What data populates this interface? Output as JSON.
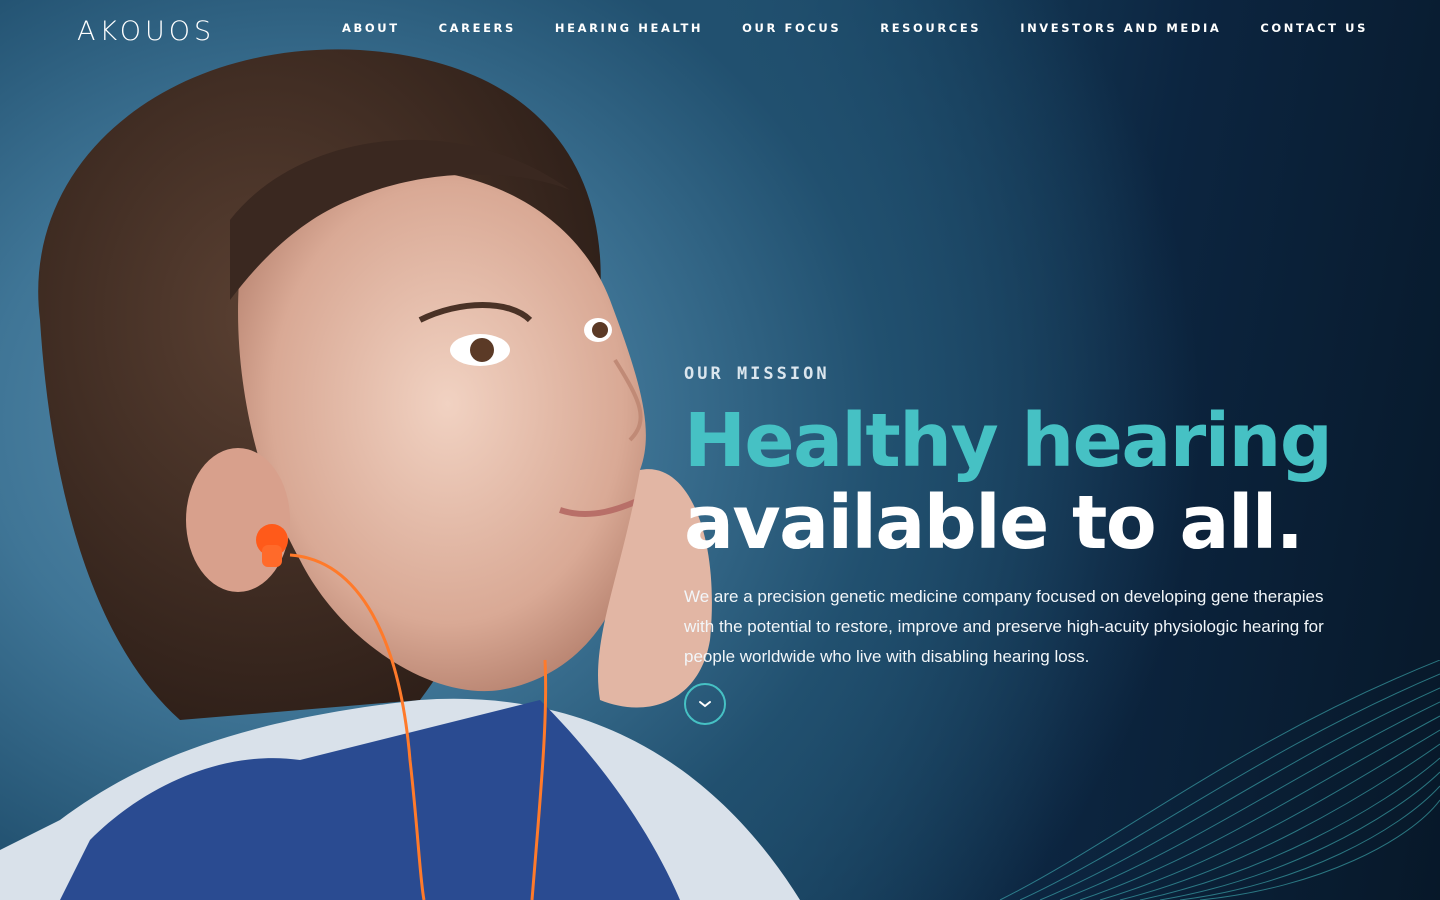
{
  "brand": {
    "logo_text": "AKOUOS"
  },
  "nav": {
    "items": [
      {
        "label": "ABOUT"
      },
      {
        "label": "CAREERS"
      },
      {
        "label": "HEARING HEALTH"
      },
      {
        "label": "OUR FOCUS"
      },
      {
        "label": "RESOURCES"
      },
      {
        "label": "INVESTORS AND MEDIA"
      },
      {
        "label": "CONTACT US"
      }
    ]
  },
  "hero": {
    "eyebrow": "OUR MISSION",
    "headline_accent": "Healthy hearing",
    "headline_plain": "available to all.",
    "description": "We are a precision genetic medicine company focused on developing gene therapies with the potential to restore, improve and preserve high-acuity physiologic hearing for people worldwide who live with disabling hearing loss.",
    "scroll_icon": "chevron-down-icon"
  },
  "colors": {
    "accent": "#46c1c4",
    "text": "#ffffff",
    "earbud": "#ff5a1a"
  }
}
